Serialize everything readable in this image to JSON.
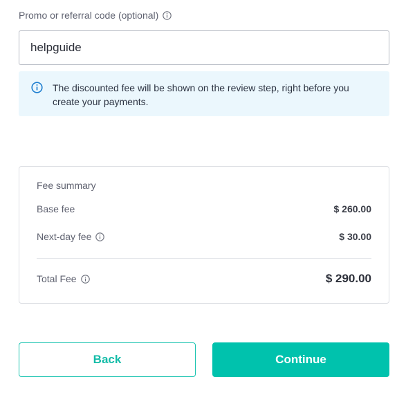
{
  "promo": {
    "label": "Promo or referral code (optional)",
    "value": "helpguide",
    "placeholder": ""
  },
  "notice": {
    "icon": "info-circle-icon",
    "text": "The discounted fee will be shown on the review step, right before you create your payments."
  },
  "fee_summary": {
    "title": "Fee summary",
    "base_fee": {
      "label": "Base fee",
      "value": "$ 260.00"
    },
    "next_day_fee": {
      "label": "Next-day fee",
      "value": "$ 30.00"
    },
    "total_fee": {
      "label": "Total Fee",
      "value": "$ 290.00"
    }
  },
  "actions": {
    "back_label": "Back",
    "continue_label": "Continue"
  },
  "colors": {
    "accent": "#00c2ad",
    "notice_background": "#ebf7fd",
    "notice_icon": "#1f7fd0",
    "muted_text": "#5f6270"
  }
}
